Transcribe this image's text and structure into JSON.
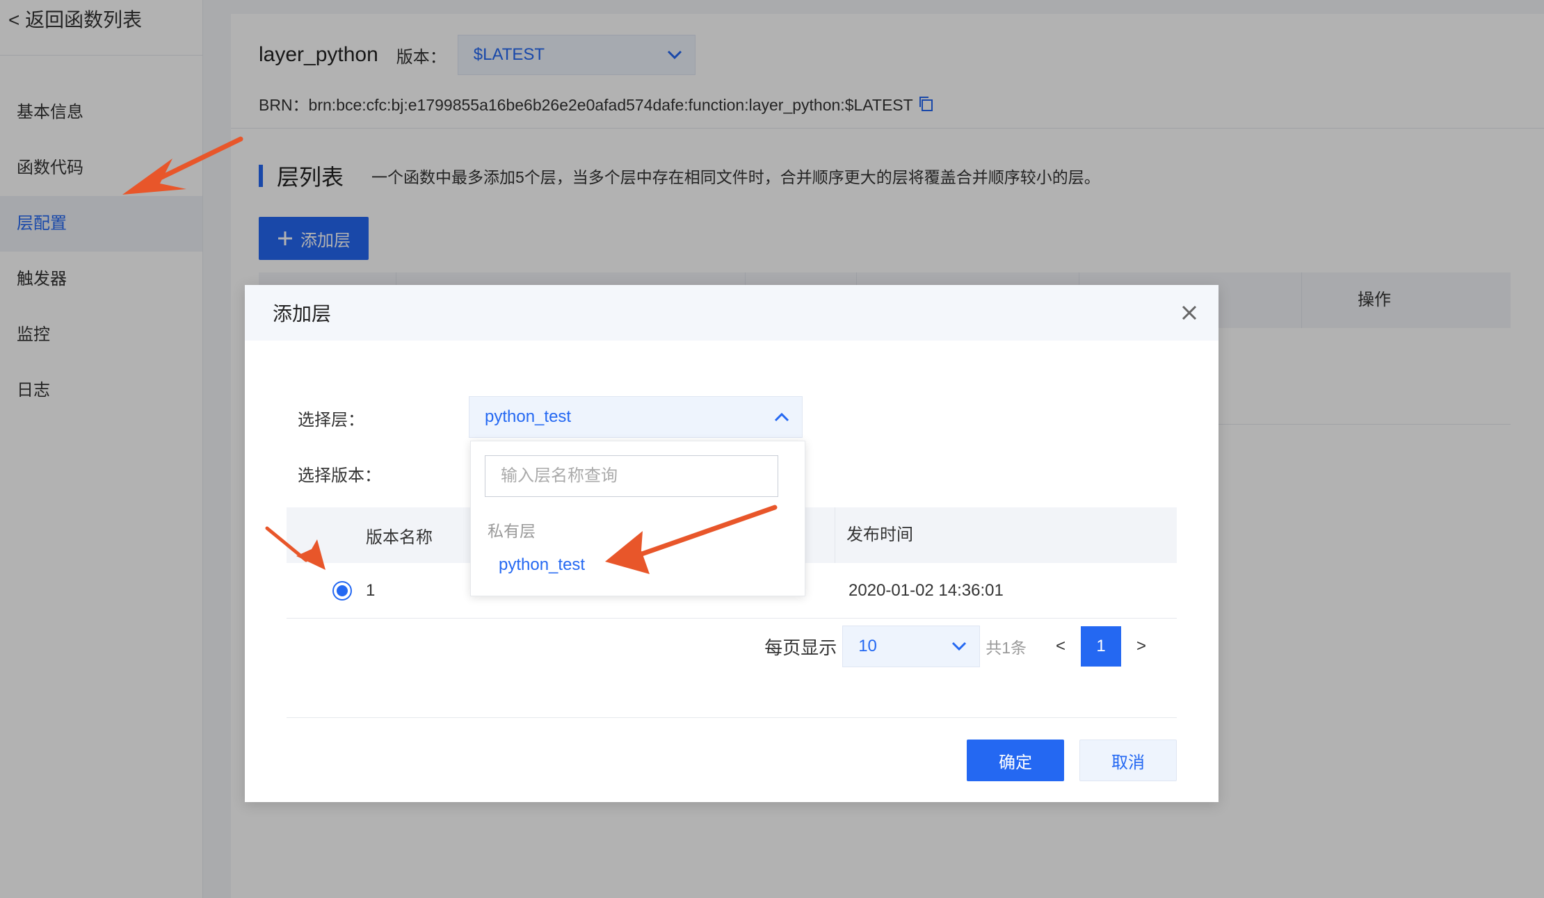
{
  "sidebar": {
    "back_label": "< 返回函数列表",
    "items": [
      {
        "label": "基本信息",
        "active": false
      },
      {
        "label": "函数代码",
        "active": false
      },
      {
        "label": "层配置",
        "active": true
      },
      {
        "label": "触发器",
        "active": false
      },
      {
        "label": "监控",
        "active": false
      },
      {
        "label": "日志",
        "active": false
      }
    ]
  },
  "header": {
    "function_name": "layer_python",
    "version_label": "版本：",
    "version_value": "$LATEST",
    "brn": "BRN：brn:bce:cfc:bj:e1799855a16be6b26e2e0afad574dafe:function:layer_python:$LATEST"
  },
  "section": {
    "title": "层列表",
    "description": "一个函数中最多添加5个层，当多个层中存在相同文件时，合并顺序更大的层将覆盖合并顺序较小的层。",
    "add_button_label": "添加层",
    "table_op_header": "操作"
  },
  "modal": {
    "title": "添加层",
    "select_layer_label": "选择层：",
    "select_layer_value": "python_test",
    "select_version_label": "选择版本：",
    "table": {
      "headers": [
        "版本名称",
        "发布时间"
      ],
      "rows": [
        {
          "version": "1",
          "published": "2020-01-02 14:36:01",
          "selected": true
        }
      ]
    },
    "pagination": {
      "per_page_label": "每页显示",
      "per_page_value": "10",
      "total": "共1条",
      "prev": "<",
      "current_page": "1",
      "next": ">"
    },
    "ok_label": "确定",
    "cancel_label": "取消"
  },
  "dropdown": {
    "search_placeholder": "输入层名称查询",
    "group_label": "私有层",
    "options": [
      "python_test"
    ]
  },
  "colors": {
    "accent": "#2468f2",
    "annotation_arrow": "#e8562a"
  }
}
